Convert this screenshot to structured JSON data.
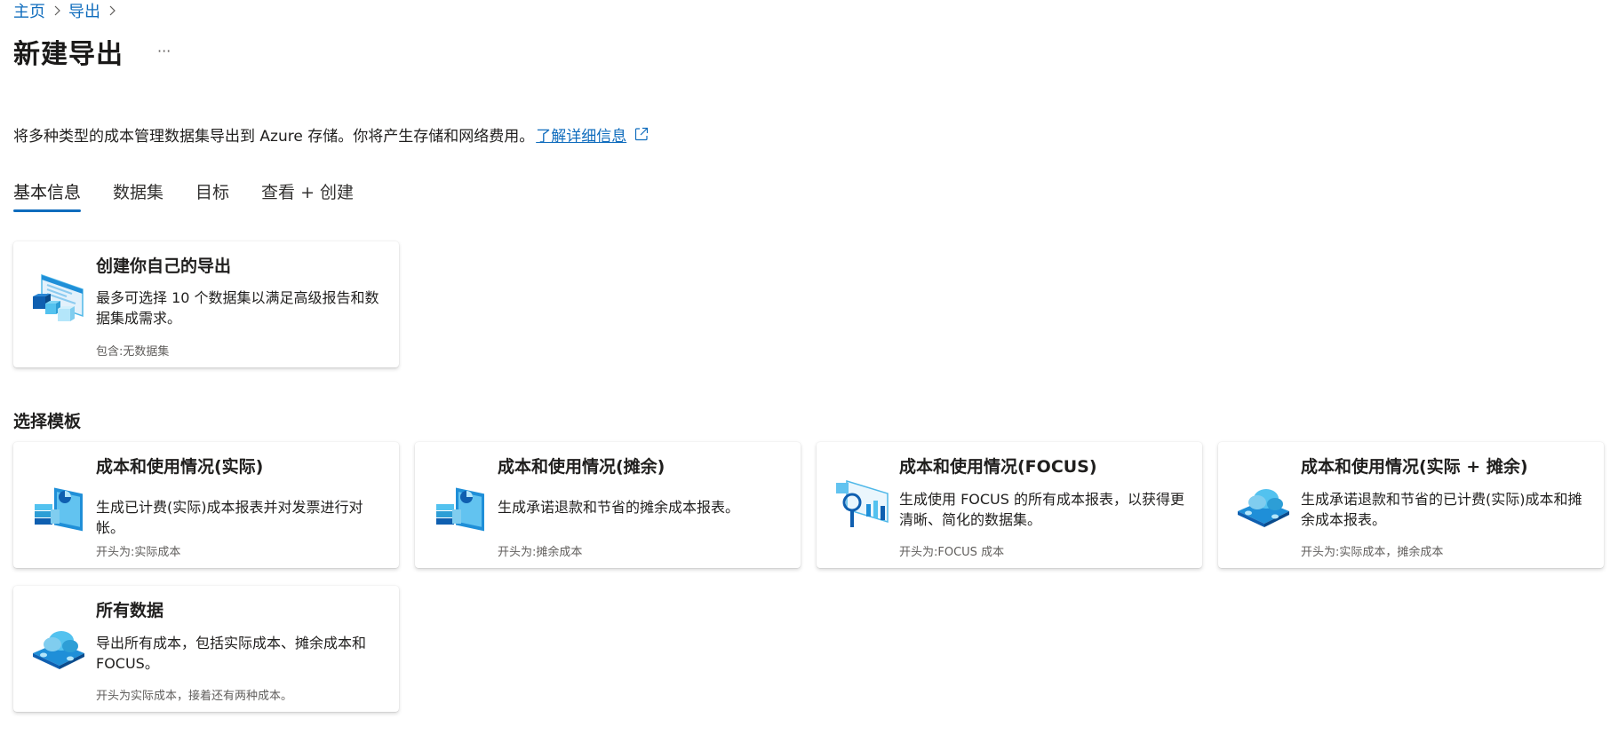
{
  "breadcrumb": [
    {
      "label": "主页"
    },
    {
      "label": "导出"
    }
  ],
  "title": "新建导出",
  "more_label": "···",
  "description": {
    "text": "将多种类型的成本管理数据集导出到 Azure 存储。你将产生存储和网络费用。",
    "link": "了解详细信息"
  },
  "tabs": [
    {
      "label": "基本信息",
      "active": true
    },
    {
      "label": "数据集"
    },
    {
      "label": "目标"
    },
    {
      "label": "查看 + 创建"
    }
  ],
  "custom_card": {
    "title": "创建你自己的导出",
    "desc": "最多可选择 10 个数据集以满足高级报告和数据集成需求。",
    "foot": "包含:无数据集"
  },
  "templates": {
    "label": "选择模板",
    "cards": [
      {
        "title": "成本和使用情况(实际)",
        "desc": "生成已计费(实际)成本报表并对发票进行对帐。",
        "foot": "开头为:实际成本"
      },
      {
        "title": "成本和使用情况(摊余)",
        "desc": "生成承诺退款和节省的摊余成本报表。",
        "foot": "开头为:摊余成本"
      },
      {
        "title": "成本和使用情况(FOCUS)",
        "desc": "生成使用 FOCUS 的所有成本报表，以获得更清晰、简化的数据集。",
        "foot": "开头为:FOCUS 成本"
      },
      {
        "title": "成本和使用情况(实际 + 摊余)",
        "desc": "生成承诺退款和节省的已计费(实际)成本和摊余成本报表。",
        "foot": "开头为:实际成本，摊余成本"
      },
      {
        "title": "所有数据",
        "desc": "导出所有成本，包括实际成本、摊余成本和 FOCUS。",
        "foot": "开头为实际成本，接着还有两种成本。"
      }
    ]
  },
  "colors": {
    "accent": "#0f6cbd",
    "text": "#201f1e",
    "secondary_text": "#605e5c"
  },
  "icons": {
    "breadcrumb_separator": "chevron-right-icon",
    "external_link": "external-link-icon",
    "custom_card": "custom-export-icon",
    "actual": "cube-chart-icon",
    "amortized": "cube-chart-icon",
    "focus": "magnifier-chart-icon",
    "actual_amortized": "cloud-stack-icon",
    "all_data": "cloud-stack-icon"
  }
}
